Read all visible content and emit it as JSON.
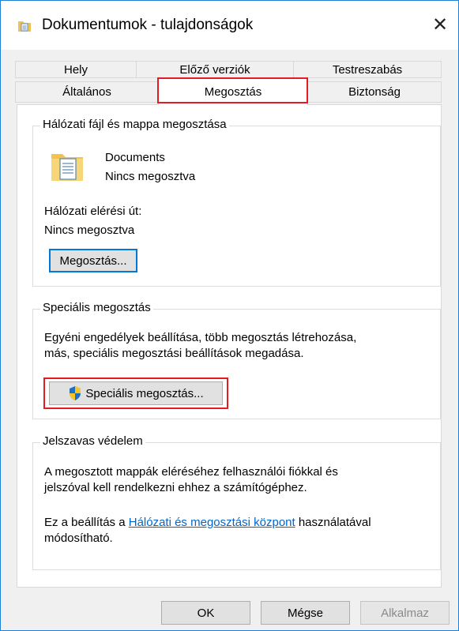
{
  "window": {
    "title": "Dokumentumok - tulajdonságok",
    "close_glyph": "✕"
  },
  "tabs_top": [
    {
      "label": "Hely"
    },
    {
      "label": "Előző verziók"
    },
    {
      "label": "Testreszabás"
    }
  ],
  "tabs_bottom": [
    {
      "label": "Általános"
    },
    {
      "label": "Megosztás",
      "active": true
    },
    {
      "label": "Biztonság"
    }
  ],
  "network_share": {
    "legend": "Hálózati fájl és mappa megosztása",
    "folder_name": "Documents",
    "folder_status": "Nincs megosztva",
    "path_label": "Hálózati elérési út:",
    "path_value": "Nincs megosztva",
    "share_button": "Megosztás..."
  },
  "advanced_share": {
    "legend": "Speciális megosztás",
    "description_line1": "Egyéni engedélyek beállítása, több megosztás létrehozása,",
    "description_line2": "más, speciális megosztási beállítások megadása.",
    "button": "Speciális megosztás..."
  },
  "password_protection": {
    "legend": "Jelszavas védelem",
    "text_line1": "A megosztott mappák eléréséhez felhasználói fiókkal és",
    "text_line2": "jelszóval kell rendelkezni ehhez a számítógéphez.",
    "info_prefix": "Ez a beállítás a ",
    "info_link": "Hálózati és megosztási központ",
    "info_suffix": " használatával",
    "info_line2": "módosítható."
  },
  "footer": {
    "ok": "OK",
    "cancel": "Mégse",
    "apply": "Alkalmaz"
  },
  "colors": {
    "accent_blue": "#0078d7",
    "highlight_red": "#e31b23",
    "link_blue": "#0066cc"
  }
}
